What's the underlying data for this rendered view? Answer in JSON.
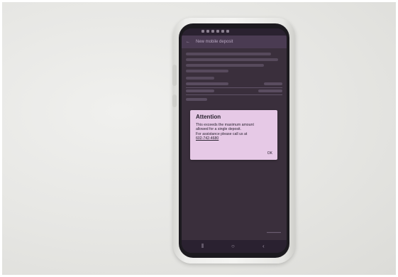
{
  "screen": {
    "toolbar": {
      "back_glyph": "←",
      "title": "New mobile deposit"
    },
    "dialog": {
      "title": "Attention",
      "body_lines": [
        "This exceeds the maximum amount",
        "allowed for a single deposit.",
        "For assistance please call us at"
      ],
      "phone": "602-742-4680",
      "ok_label": "OK"
    },
    "nav": {
      "recent_glyph": "⦀",
      "home_glyph": "○",
      "back_glyph": "‹"
    }
  },
  "colors": {
    "dialog_background": "#e6c9e6",
    "screen_background": "#3a2f3c",
    "toolbar_background": "#4a3b52"
  }
}
